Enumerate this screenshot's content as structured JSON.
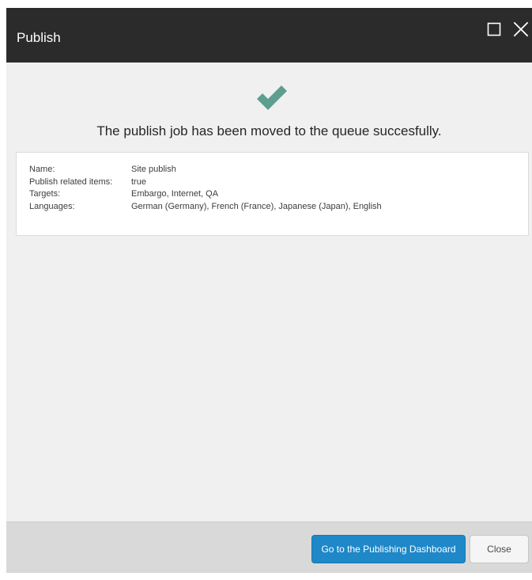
{
  "dialog": {
    "title": "Publish",
    "maximize_icon": "maximize-icon",
    "close_icon": "close-icon"
  },
  "status": {
    "icon": "checkmark-icon",
    "icon_color": "#5e9e8f",
    "message": "The publish job has been moved to the queue succesfully."
  },
  "summary": {
    "rows": [
      {
        "label": "Name:",
        "value": "Site publish"
      },
      {
        "label": "Publish related items:",
        "value": "true"
      },
      {
        "label": "Targets:",
        "value": "Embargo, Internet, QA"
      },
      {
        "label": "Languages:",
        "value": "German (Germany), French (France), Japanese (Japan), English"
      }
    ]
  },
  "footer": {
    "primary_label": "Go to the Publishing Dashboard",
    "secondary_label": "Close"
  },
  "colors": {
    "titlebar": "#2b2b2b",
    "primary_button": "#1e88c8",
    "body_bg": "#f0f0f0",
    "footer_bg": "#d9d9d9"
  }
}
